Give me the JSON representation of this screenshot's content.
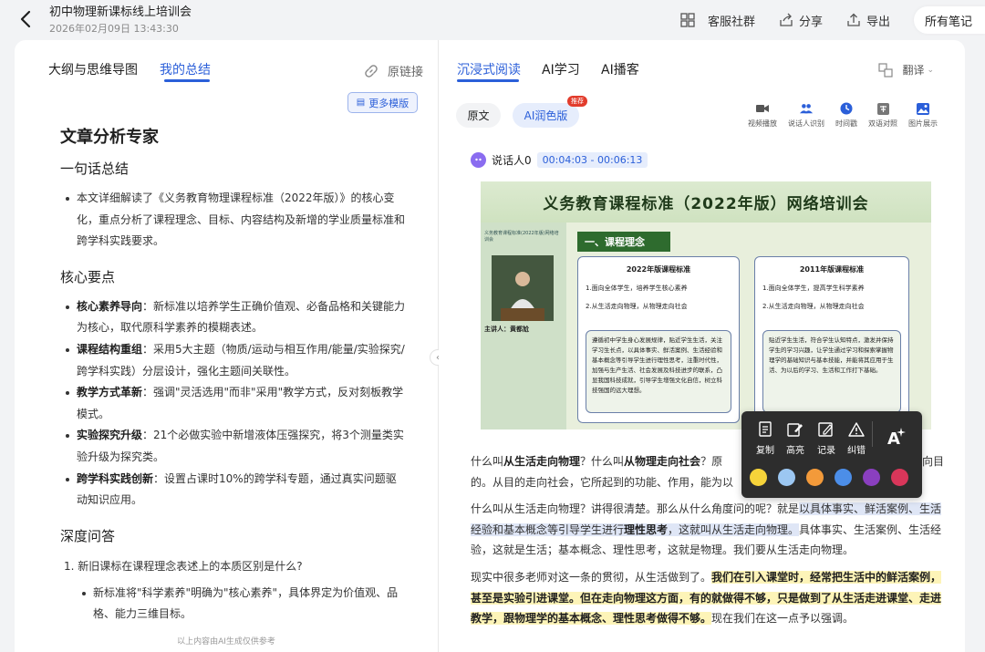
{
  "header": {
    "title": "初中物理新课标线上培训会",
    "datetime": "2026年02月09日 13:43:30",
    "actions": {
      "service": "客服社群",
      "share": "分享",
      "export": "导出"
    },
    "all_notes": "所有笔记"
  },
  "left": {
    "tabs": {
      "outline": "大纲与思维导图",
      "summary": "我的总结"
    },
    "orig_link": "原链接",
    "more_templates": "更多模版",
    "summary": {
      "heading": "文章分析专家",
      "one_line_title": "一句话总结",
      "one_line": "本文详细解读了《义务教育物理课程标准（2022年版）》的核心变化，重点分析了课程理念、目标、内容结构及新增的学业质量标准和跨学科实践要求。",
      "key_points_title": "核心要点",
      "key_points": [
        {
          "term": "核心素养导向",
          "text": "：新标准以培养学生正确价值观、必备品格和关键能力为核心，取代原科学素养的模糊表述。"
        },
        {
          "term": "课程结构重组",
          "text": "：采用5大主题（物质/运动与相互作用/能量/实验探究/跨学科实践）分层设计，强化主题间关联性。"
        },
        {
          "term": "教学方式革新",
          "text": "：强调\"灵活选用\"而非\"采用\"教学方式，反对刻板教学模式。"
        },
        {
          "term": "实验探究升级",
          "text": "：21个必做实验中新增液体压强探究，将3个测量类实验升级为探究类。"
        },
        {
          "term": "跨学科实践创新",
          "text": "：设置占课时10%的跨学科专题，通过真实问题驱动知识应用。"
        }
      ],
      "deep_qa_title": "深度问答",
      "question_1": "1. 新旧课标在课程理念表述上的本质区别是什么?",
      "answer_1": "新标准将\"科学素养\"明确为\"核心素养\"，具体界定为价值观、品格、能力三维目标。"
    },
    "footer_note": "以上内容由AI生成仅供参考"
  },
  "right": {
    "tabs": {
      "immersive": "沉浸式阅读",
      "ai_learn": "AI学习",
      "ai_broadcast": "AI播客"
    },
    "translate": "翻译",
    "pills": {
      "original": "原文",
      "ai_polish": "AI润色版",
      "badge": "推荐"
    },
    "tools": [
      {
        "label": "视频播放",
        "icon": "video-icon"
      },
      {
        "label": "说话人识别",
        "icon": "speaker-icon"
      },
      {
        "label": "时间戳",
        "icon": "clock-icon"
      },
      {
        "label": "双语对照",
        "icon": "translate-icon"
      },
      {
        "label": "图片展示",
        "icon": "image-icon"
      }
    ],
    "speaker": {
      "name": "说话人0",
      "time": "00:04:03 - 00:06:13"
    },
    "slide": {
      "banner": "义务教育课程标准（2022年版）网络培训会",
      "section": "一、课程理念",
      "host": "主讲人：黄都尬",
      "left_top": "义务教育课程标准(2022年版)网络培训会",
      "card1_title": "2022年版课程标准",
      "card1_lines": [
        "1.面向全体学生，培养学生核心素养",
        "2.从生活走向物理，从物理走向社会"
      ],
      "card1_box": "遵循初中学生身心发展规律，贴近学生生活，关注学习生长点，以具体事实、鲜活案例、生活经验和基本概念等引导学生进行理性思考，注重时代性，加强与生产生活、社会发展及科技进步的联系，凸显我国科技成就，引导学生增强文化自信，树立科技强国的远大理想。",
      "card2_title": "2011年版课程标准",
      "card2_lines": [
        "1.面向全体学生，提高学生科学素养",
        "2.从生活走向物理，从物理走向社会"
      ],
      "card2_box": "贴近学生生活，符合学生认知特点，激发并保持学生的学习兴趣，让学生通过学习和探索掌握物理学的基础知识与基本技能，并能将其应用于生活、为以后的学习、生活和工作打下基础。"
    },
    "transcript": {
      "p1_a": "什么叫",
      "p1_b": "从生活走向物理",
      "p1_c": "？什么叫",
      "p1_d": "从物理走向社会",
      "p1_e": "？原",
      "p1_f": "向目",
      "p1_line2": "的。从目的走向社会，它所起到的功能、作用，能为以",
      "p2_a": "什么叫从生活走向物理？讲得很清楚。那么从什么角度问的呢？就是",
      "p2_hl1": "以具体事实、鲜活案例、",
      "p2_hl2": "生活经验和基本概念等引导学生进行",
      "p2_hl_bold": "理性思考",
      "p2_hl3": "，这就叫从生活走向物理。",
      "p2_b": "具体事实、生活案例、生活经验，这就是生活；基本概念、理性思考，这就是物理。我们要从生活走向物理。",
      "p3_a": "现实中很多老师对这一条的贯彻，从生活做到了。",
      "p3_hl": "我们在引入课堂时，经常把生活中的鲜活案例，甚至是实验引进课堂。但在走向物理这方面，有的就做得不够，只是做到了从生活走进课堂、走进教学，跟物理学的基本概念、理性思考做得不够。",
      "p3_b": "现在我们在这一点予以强调。"
    }
  },
  "context_menu": {
    "copy": "复制",
    "highlight": "高亮",
    "note": "记录",
    "correct": "纠错",
    "colors": [
      "#f6d33a",
      "#9cc7f2",
      "#f39a3a",
      "#4c8ee8",
      "#8a3fbf",
      "#d9365a"
    ]
  }
}
